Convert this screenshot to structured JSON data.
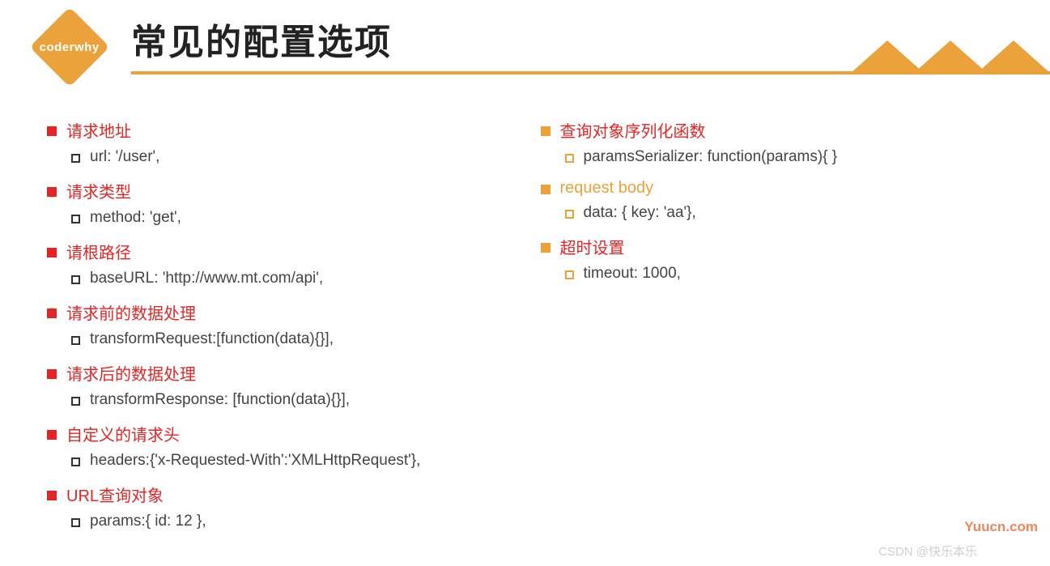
{
  "logo": "coderwhy",
  "title": "常见的配置选项",
  "left": [
    {
      "heading": "请求地址",
      "sub": "url: '/user',"
    },
    {
      "heading": "请求类型",
      "sub": "method: 'get',"
    },
    {
      "heading": "请根路径",
      "sub": "baseURL: 'http://www.mt.com/api',"
    },
    {
      "heading": "请求前的数据处理",
      "sub": "transformRequest:[function(data){}],"
    },
    {
      "heading": "请求后的数据处理",
      "sub": "transformResponse: [function(data){}],"
    },
    {
      "heading": "自定义的请求头",
      "sub": "headers:{'x-Requested-With':'XMLHttpRequest'},"
    },
    {
      "heading": "URL查询对象",
      "sub": "params:{ id: 12 },"
    }
  ],
  "right": [
    {
      "heading": "查询对象序列化函数",
      "sub": "paramsSerializer: function(params){ }"
    },
    {
      "heading": "request body",
      "sub": "data: { key: 'aa'},"
    },
    {
      "heading": "超时设置",
      "sub": "timeout: 1000,"
    }
  ],
  "watermark1": "Yuucn.com",
  "watermark2": "CSDN @快乐本乐"
}
